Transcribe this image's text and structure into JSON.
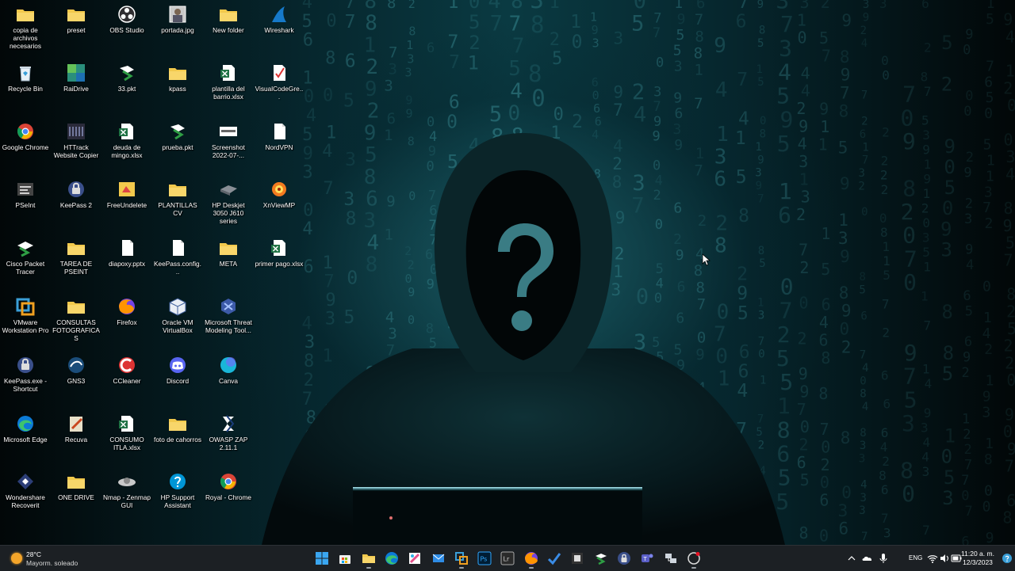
{
  "desktop": {
    "icons": [
      {
        "label": "copia de archivos necesarios",
        "icon": "folder-icon"
      },
      {
        "label": "Recycle Bin",
        "icon": "recycle-bin-icon"
      },
      {
        "label": "Google Chrome",
        "icon": "chrome-icon"
      },
      {
        "label": "PSeInt",
        "icon": "pseint-icon"
      },
      {
        "label": "Cisco Packet Tracer",
        "icon": "cisco-packet-tracer-icon"
      },
      {
        "label": "VMware Workstation Pro",
        "icon": "vmware-icon"
      },
      {
        "label": "KeePass.exe - Shortcut",
        "icon": "keepass-icon"
      },
      {
        "label": "Microsoft Edge",
        "icon": "edge-icon"
      },
      {
        "label": "Wondershare Recoverit",
        "icon": "recoverit-icon"
      },
      {
        "label": "preset",
        "icon": "folder-icon"
      },
      {
        "label": "RaiDrive",
        "icon": "raidrive-icon"
      },
      {
        "label": "HTTrack Website Copier",
        "icon": "httrack-icon"
      },
      {
        "label": "KeePass 2",
        "icon": "keepass-icon"
      },
      {
        "label": "TAREA DE PSEINT",
        "icon": "folder-icon"
      },
      {
        "label": "CONSULTAS FOTOGRAFICAS",
        "icon": "folder-icon"
      },
      {
        "label": "GNS3",
        "icon": "gns3-icon"
      },
      {
        "label": "Recuva",
        "icon": "recuva-icon"
      },
      {
        "label": "ONE DRIVE",
        "icon": "folder-icon"
      },
      {
        "label": "OBS Studio",
        "icon": "obs-icon"
      },
      {
        "label": "33.pkt",
        "icon": "pkt-file-icon"
      },
      {
        "label": "deuda de mingo.xlsx",
        "icon": "excel-file-icon"
      },
      {
        "label": "FreeUndelete",
        "icon": "freeundelete-icon"
      },
      {
        "label": "diapoxy.pptx",
        "icon": "blank-file-icon"
      },
      {
        "label": "Firefox",
        "icon": "firefox-icon"
      },
      {
        "label": "CCleaner",
        "icon": "ccleaner-icon"
      },
      {
        "label": "CONSUMO ITLA.xlsx",
        "icon": "excel-file-icon"
      },
      {
        "label": "Nmap - Zenmap GUI",
        "icon": "nmap-icon"
      },
      {
        "label": "portada.jpg",
        "icon": "image-file-icon"
      },
      {
        "label": "kpass",
        "icon": "folder-icon"
      },
      {
        "label": "prueba.pkt",
        "icon": "pkt-file-icon"
      },
      {
        "label": "PLANTILLAS CV",
        "icon": "folder-icon"
      },
      {
        "label": "KeePass.config...",
        "icon": "blank-file-icon"
      },
      {
        "label": "Oracle VM VirtualBox",
        "icon": "virtualbox-icon"
      },
      {
        "label": "Discord",
        "icon": "discord-icon"
      },
      {
        "label": "foto de cahorros",
        "icon": "folder-icon"
      },
      {
        "label": "HP Support Assistant",
        "icon": "hp-support-icon"
      },
      {
        "label": "New folder",
        "icon": "folder-icon"
      },
      {
        "label": "plantilla del barrio.xlsx",
        "icon": "excel-file-icon"
      },
      {
        "label": "Screenshot 2022-07-...",
        "icon": "screenshot-file-icon"
      },
      {
        "label": "HP Deskjet 3050 J610 series",
        "icon": "printer-icon"
      },
      {
        "label": "META",
        "icon": "folder-icon"
      },
      {
        "label": "Microsoft Threat Modeling Tool...",
        "icon": "threat-modeling-icon"
      },
      {
        "label": "Canva",
        "icon": "canva-icon"
      },
      {
        "label": "OWASP ZAP 2.11.1",
        "icon": "owasp-zap-icon"
      },
      {
        "label": "Royal - Chrome",
        "icon": "chrome-icon"
      },
      {
        "label": "Wireshark",
        "icon": "wireshark-icon"
      },
      {
        "label": "VisualCodeGre...",
        "icon": "checklist-file-icon"
      },
      {
        "label": "NordVPN",
        "icon": "blank-file-icon"
      },
      {
        "label": "XnViewMP",
        "icon": "xnview-icon"
      },
      {
        "label": "primer pago.xlsx",
        "icon": "excel-file-icon"
      }
    ]
  },
  "taskbar": {
    "weather": {
      "temp": "28°C",
      "condition": "Mayorm. soleado",
      "icon": "sun-icon"
    },
    "apps": [
      {
        "name": "start-button",
        "icon": "windows-logo-icon",
        "running": false
      },
      {
        "name": "microsoft-store",
        "icon": "store-icon",
        "running": false
      },
      {
        "name": "file-explorer",
        "icon": "folder-icon",
        "running": true
      },
      {
        "name": "edge",
        "icon": "edge-icon",
        "running": false
      },
      {
        "name": "snipping",
        "icon": "paint-icon",
        "running": false
      },
      {
        "name": "mail",
        "icon": "mail-icon",
        "running": false
      },
      {
        "name": "vmware",
        "icon": "vmware-icon",
        "running": true
      },
      {
        "name": "photoshop",
        "icon": "photoshop-icon",
        "running": false
      },
      {
        "name": "lightroom",
        "icon": "lightroom-icon",
        "running": false
      },
      {
        "name": "firefox",
        "icon": "firefox-icon",
        "running": true
      },
      {
        "name": "todo",
        "icon": "checkmark-icon",
        "running": false
      },
      {
        "name": "terminal",
        "icon": "terminal-icon",
        "running": false
      },
      {
        "name": "packet-tracer",
        "icon": "cisco-packet-tracer-icon",
        "running": false
      },
      {
        "name": "keepass",
        "icon": "keepass-icon",
        "running": false
      },
      {
        "name": "teams",
        "icon": "teams-icon",
        "running": false
      },
      {
        "name": "network-tool",
        "icon": "network-icon",
        "running": false
      },
      {
        "name": "recording-app",
        "icon": "record-icon",
        "running": true
      }
    ],
    "tray": {
      "lang": "ENG",
      "time": "11:20 a. m.",
      "date": "12/3/2023"
    }
  },
  "colors": {
    "folder": "#f2c94c",
    "taskbar": "#1c2024",
    "accent": "#3a9fd8",
    "excel": "#1f7244"
  }
}
